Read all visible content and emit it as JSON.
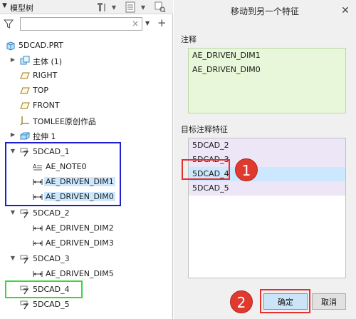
{
  "model_tree": {
    "title": "模型树",
    "search": {
      "value": "",
      "placeholder": ""
    },
    "items": [
      {
        "label": "5DCAD.PRT",
        "icon": "part-icon"
      },
      {
        "label": "主体 (1)",
        "icon": "body-icon"
      },
      {
        "label": "RIGHT",
        "icon": "datum-plane-icon"
      },
      {
        "label": "TOP",
        "icon": "datum-plane-icon"
      },
      {
        "label": "FRONT",
        "icon": "datum-plane-icon"
      },
      {
        "label": "TOMLEE原创作品",
        "icon": "coordinate-system-icon"
      },
      {
        "label": "拉伸 1",
        "icon": "extrude-icon"
      },
      {
        "label": "5DCAD_1",
        "icon": "annotation-feature-icon"
      },
      {
        "label": "AE_NOTE0",
        "icon": "note-icon"
      },
      {
        "label": "AE_DRIVEN_DIM1",
        "icon": "dimension-icon",
        "selected": true
      },
      {
        "label": "AE_DRIVEN_DIM0",
        "icon": "dimension-icon",
        "selected": true
      },
      {
        "label": "5DCAD_2",
        "icon": "annotation-feature-icon"
      },
      {
        "label": "AE_DRIVEN_DIM2",
        "icon": "dimension-icon"
      },
      {
        "label": "AE_DRIVEN_DIM3",
        "icon": "dimension-icon"
      },
      {
        "label": "5DCAD_3",
        "icon": "annotation-feature-icon"
      },
      {
        "label": "AE_DRIVEN_DIM5",
        "icon": "dimension-icon"
      },
      {
        "label": "5DCAD_4",
        "icon": "annotation-feature-icon"
      },
      {
        "label": "5DCAD_5",
        "icon": "annotation-feature-icon"
      }
    ]
  },
  "dialog": {
    "title": "移动到另一个特征",
    "annotations_label": "注释",
    "annotations": [
      "AE_DRIVEN_DIM1",
      "AE_DRIVEN_DIM0"
    ],
    "target_label": "目标注释特征",
    "targets": [
      "5DCAD_2",
      "5DCAD_3",
      "5DCAD_4",
      "5DCAD_5"
    ],
    "selected_target": "5DCAD_4",
    "ok_label": "确定",
    "cancel_label": "取消"
  },
  "steps": [
    "1",
    "2"
  ],
  "colors": {
    "highlight": "#cce8ff",
    "annotation_list_bg": "#e8f7d9",
    "target_item_bg": "#ede6f7",
    "step_badge": "#e03a2f",
    "callout_red": "#e53030",
    "callout_blue": "#1f1fd0",
    "callout_green": "#3bd63b"
  }
}
